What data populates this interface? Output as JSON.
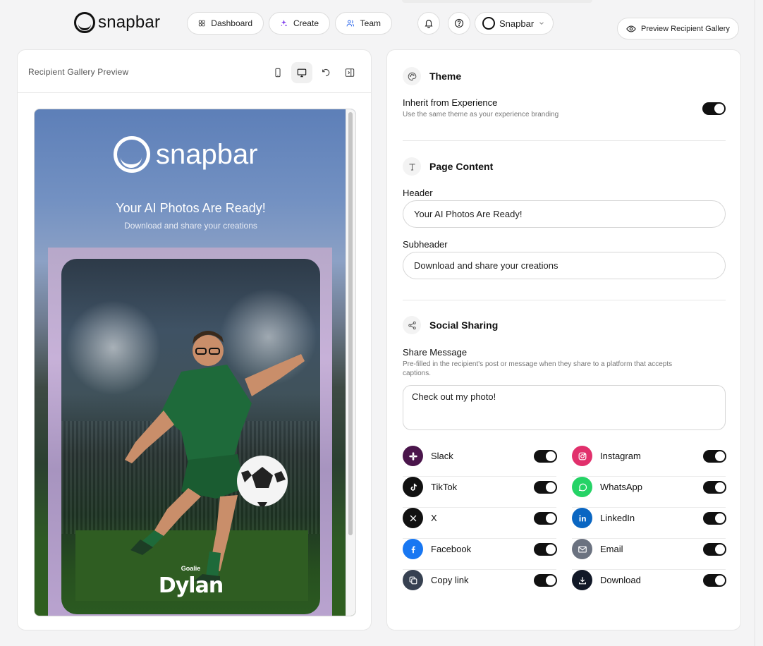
{
  "header": {
    "brand": "snapbar",
    "nav": [
      {
        "label": "Dashboard",
        "icon": "grid-icon"
      },
      {
        "label": "Create",
        "icon": "sparkle-icon"
      },
      {
        "label": "Team",
        "icon": "users-icon"
      }
    ],
    "account_label": "Snapbar",
    "preview_button": "Preview Recipient Gallery"
  },
  "preview": {
    "panel_title": "Recipient Gallery Preview",
    "brand": "snapbar",
    "title": "Your AI Photos Are Ready!",
    "subtitle": "Download and share your creations",
    "photo_caption_small": "Goalie",
    "photo_caption_name": "Dylan"
  },
  "settings": {
    "theme": {
      "title": "Theme",
      "inherit_label": "Inherit from Experience",
      "inherit_hint": "Use the same theme as your experience branding",
      "inherit_on": true
    },
    "page_content": {
      "title": "Page Content",
      "header_label": "Header",
      "header_value": "Your AI Photos Are Ready!",
      "subheader_label": "Subheader",
      "subheader_value": "Download and share your creations"
    },
    "social_sharing": {
      "title": "Social Sharing",
      "share_message_label": "Share Message",
      "share_message_hint_line1": "Pre-filled in the recipient's post or message when they share to a platform that accepts",
      "share_message_hint_line2": "captions.",
      "share_message_value": "Check out my photo!",
      "platforms": [
        {
          "label": "Slack",
          "icon": "slack-icon",
          "color": "#4a154b",
          "enabled": true
        },
        {
          "label": "Instagram",
          "icon": "instagram-icon",
          "color": "#e1306c",
          "enabled": true
        },
        {
          "label": "TikTok",
          "icon": "tiktok-icon",
          "color": "#111111",
          "enabled": true
        },
        {
          "label": "WhatsApp",
          "icon": "whatsapp-icon",
          "color": "#25d366",
          "enabled": true
        },
        {
          "label": "X",
          "icon": "x-icon",
          "color": "#111111",
          "enabled": true
        },
        {
          "label": "LinkedIn",
          "icon": "linkedin-icon",
          "color": "#0a66c2",
          "enabled": true
        },
        {
          "label": "Facebook",
          "icon": "facebook-icon",
          "color": "#1877f2",
          "enabled": true
        },
        {
          "label": "Email",
          "icon": "mail-icon",
          "color": "#6b7280",
          "enabled": true
        },
        {
          "label": "Copy link",
          "icon": "copy-icon",
          "color": "#374151",
          "enabled": true
        },
        {
          "label": "Download",
          "icon": "download-icon",
          "color": "#111827",
          "enabled": true
        }
      ]
    }
  }
}
